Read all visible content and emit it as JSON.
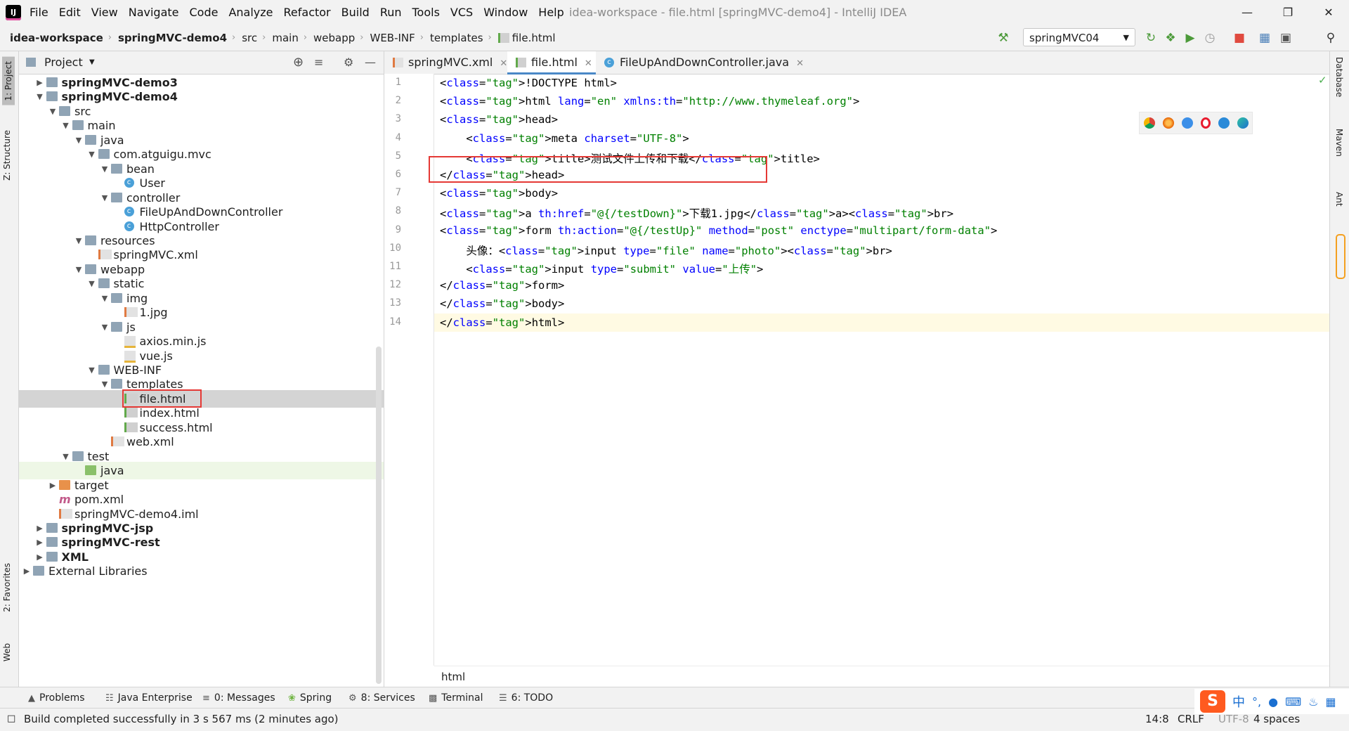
{
  "menu": [
    "File",
    "Edit",
    "View",
    "Navigate",
    "Code",
    "Analyze",
    "Refactor",
    "Build",
    "Run",
    "Tools",
    "VCS",
    "Window",
    "Help"
  ],
  "window_title": "idea-workspace - file.html [springMVC-demo4] - IntelliJ IDEA",
  "breadcrumbs": [
    "idea-workspace",
    "springMVC-demo4",
    "src",
    "main",
    "webapp",
    "WEB-INF",
    "templates",
    "file.html"
  ],
  "run_config": "springMVC04",
  "left_tabs": {
    "project": "1: Project",
    "structure": "Z: Structure",
    "favorites": "2: Favorites",
    "web": "Web"
  },
  "right_tabs": {
    "database": "Database",
    "maven": "Maven",
    "ant": "Ant"
  },
  "project_panel": {
    "title": "Project"
  },
  "tree": [
    {
      "label": "springMVC-demo3",
      "depth": 0,
      "arrow": "▶",
      "icon": "module",
      "bold": true
    },
    {
      "label": "springMVC-demo4",
      "depth": 0,
      "arrow": "▼",
      "icon": "module",
      "bold": true
    },
    {
      "label": "src",
      "depth": 1,
      "arrow": "▼",
      "icon": "folder"
    },
    {
      "label": "main",
      "depth": 2,
      "arrow": "▼",
      "icon": "folder"
    },
    {
      "label": "java",
      "depth": 3,
      "arrow": "▼",
      "icon": "folder-blue"
    },
    {
      "label": "com.atguigu.mvc",
      "depth": 4,
      "arrow": "▼",
      "icon": "package"
    },
    {
      "label": "bean",
      "depth": 5,
      "arrow": "▼",
      "icon": "package"
    },
    {
      "label": "User",
      "depth": 6,
      "arrow": "",
      "icon": "class"
    },
    {
      "label": "controller",
      "depth": 5,
      "arrow": "▼",
      "icon": "package"
    },
    {
      "label": "FileUpAndDownController",
      "depth": 6,
      "arrow": "",
      "icon": "class"
    },
    {
      "label": "HttpController",
      "depth": 6,
      "arrow": "",
      "icon": "class"
    },
    {
      "label": "resources",
      "depth": 3,
      "arrow": "▼",
      "icon": "folder"
    },
    {
      "label": "springMVC.xml",
      "depth": 4,
      "arrow": "",
      "icon": "xml"
    },
    {
      "label": "webapp",
      "depth": 3,
      "arrow": "▼",
      "icon": "folder-blue"
    },
    {
      "label": "static",
      "depth": 4,
      "arrow": "▼",
      "icon": "folder"
    },
    {
      "label": "img",
      "depth": 5,
      "arrow": "▼",
      "icon": "folder"
    },
    {
      "label": "1.jpg",
      "depth": 6,
      "arrow": "",
      "icon": "image"
    },
    {
      "label": "js",
      "depth": 5,
      "arrow": "▼",
      "icon": "folder"
    },
    {
      "label": "axios.min.js",
      "depth": 6,
      "arrow": "",
      "icon": "js"
    },
    {
      "label": "vue.js",
      "depth": 6,
      "arrow": "",
      "icon": "js"
    },
    {
      "label": "WEB-INF",
      "depth": 4,
      "arrow": "▼",
      "icon": "folder"
    },
    {
      "label": "templates",
      "depth": 5,
      "arrow": "▼",
      "icon": "folder"
    },
    {
      "label": "file.html",
      "depth": 6,
      "arrow": "",
      "icon": "html",
      "selected": true
    },
    {
      "label": "index.html",
      "depth": 6,
      "arrow": "",
      "icon": "html"
    },
    {
      "label": "success.html",
      "depth": 6,
      "arrow": "",
      "icon": "html"
    },
    {
      "label": "web.xml",
      "depth": 5,
      "arrow": "",
      "icon": "xml"
    },
    {
      "label": "test",
      "depth": 2,
      "arrow": "▼",
      "icon": "folder"
    },
    {
      "label": "java",
      "depth": 3,
      "arrow": "",
      "icon": "folder-green",
      "green": true
    },
    {
      "label": "target",
      "depth": 1,
      "arrow": "▶",
      "icon": "folder-orange"
    },
    {
      "label": "pom.xml",
      "depth": 1,
      "arrow": "",
      "icon": "maven"
    },
    {
      "label": "springMVC-demo4.iml",
      "depth": 1,
      "arrow": "",
      "icon": "iml"
    },
    {
      "label": "springMVC-jsp",
      "depth": 0,
      "arrow": "▶",
      "icon": "module",
      "bold": true
    },
    {
      "label": "springMVC-rest",
      "depth": 0,
      "arrow": "▶",
      "icon": "module",
      "bold": true
    },
    {
      "label": "XML",
      "depth": 0,
      "arrow": "▶",
      "icon": "module",
      "bold": true
    },
    {
      "label": "External Libraries",
      "depth": -1,
      "arrow": "▶",
      "icon": "library"
    }
  ],
  "editor_tabs": [
    {
      "label": "springMVC.xml",
      "icon": "xml"
    },
    {
      "label": "file.html",
      "icon": "html",
      "active": true
    },
    {
      "label": "FileUpAndDownController.java",
      "icon": "class"
    }
  ],
  "code_lines": [
    "<!DOCTYPE html>",
    "<html lang=\"en\" xmlns:th=\"http://www.thymeleaf.org\">",
    "<head>",
    "    <meta charset=\"UTF-8\">",
    "    <title>测试文件上传和下载</title>",
    "</head>",
    "<body>",
    "<a th:href=\"@{/testDown}\">下载1.jpg</a><br>",
    "<form th:action=\"@{/testUp}\" method=\"post\" enctype=\"multipart/form-data\">",
    "    头像：<input type=\"file\" name=\"photo\"><br>",
    "    <input type=\"submit\" value=\"上传\">",
    "</form>",
    "</body>",
    "</html>"
  ],
  "editor_footer": "html",
  "bottom_tabs": [
    "Problems",
    "Java Enterprise",
    "0: Messages",
    "Spring",
    "8: Services",
    "Terminal",
    "6: TODO"
  ],
  "status": {
    "message": "Build completed successfully in 3 s 567 ms (2 minutes ago)",
    "position": "14:8",
    "line_sep": "CRLF",
    "encoding": "UTF-8",
    "indent": "4 spaces"
  },
  "ime": {
    "label": "中"
  }
}
